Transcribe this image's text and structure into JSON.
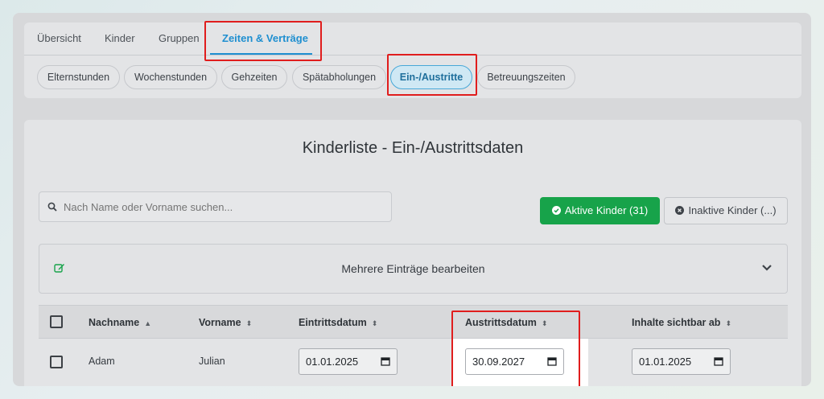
{
  "tabs": [
    "Übersicht",
    "Kinder",
    "Gruppen",
    "Zeiten & Verträge"
  ],
  "subtabs": [
    "Elternstunden",
    "Wochenstunden",
    "Gehzeiten",
    "Spätabholungen",
    "Ein-/Austritte",
    "Betreuungszeiten"
  ],
  "page_title": "Kinderliste - Ein-/Austrittsdaten",
  "search": {
    "placeholder": "Nach Name oder Vorname suchen..."
  },
  "filters": {
    "active_label": "Aktive Kinder (31)",
    "inactive_label": "Inaktive Kinder (...)"
  },
  "bulk_edit": {
    "label": "Mehrere Einträge bearbeiten"
  },
  "table": {
    "headers": [
      "Nachname",
      "Vorname",
      "Eintrittsdatum",
      "Austrittsdatum",
      "Inhalte sichtbar ab"
    ],
    "rows": [
      {
        "nachname": "Adam",
        "vorname": "Julian",
        "eintritt": "01.01.2025",
        "austritt": "30.09.2027",
        "sichtbar": "01.01.2025"
      }
    ]
  },
  "colors": {
    "accent": "#1f8fd0",
    "success": "#17a34a",
    "highlight": "#e01d1d"
  }
}
